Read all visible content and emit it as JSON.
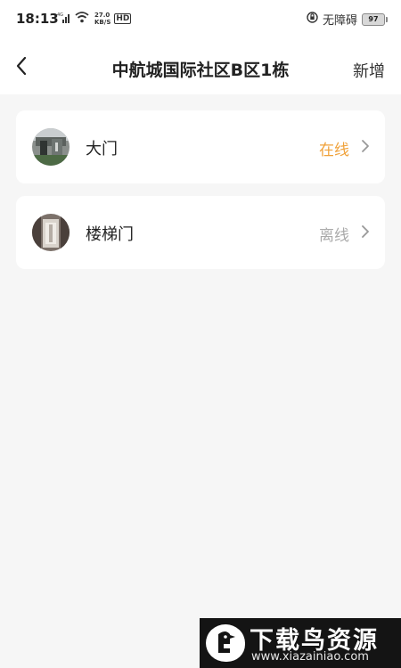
{
  "status_bar": {
    "time": "18:13",
    "speed_value": "27.0",
    "speed_unit": "KB/S",
    "hd_label": "HD",
    "accessibility_label": "无障碍",
    "battery_level": "97",
    "icons": [
      "signal-icon",
      "wifi-icon",
      "accessibility-icon",
      "battery-icon"
    ]
  },
  "nav": {
    "back_icon": "back-chevron-icon",
    "title": "中航城国际社区B区1栋",
    "action_label": "新增"
  },
  "devices": [
    {
      "name": "大门",
      "status": "在线",
      "status_color": "#f0a23b",
      "thumb_icon": "gate-photo-thumbnail"
    },
    {
      "name": "楼梯门",
      "status": "离线",
      "status_color": "#aaaaaa",
      "thumb_icon": "stair-door-photo-thumbnail"
    }
  ],
  "watermark": {
    "title": "下载鸟资源",
    "url": "www.xiazainiao.com"
  },
  "colors": {
    "background": "#f6f6f6",
    "card": "#ffffff",
    "online": "#f0a23b",
    "offline": "#aaaaaa"
  }
}
